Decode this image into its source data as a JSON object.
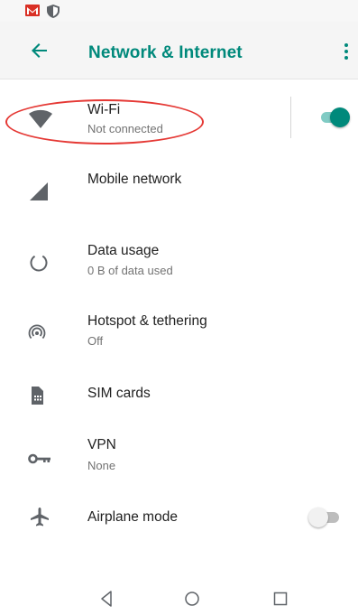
{
  "statusbar": {
    "icons": [
      "gmail-icon",
      "shield-icon"
    ]
  },
  "toolbar": {
    "title": "Network & Internet",
    "accent_color": "#00897b"
  },
  "items": [
    {
      "id": "wifi",
      "title": "Wi-Fi",
      "subtitle": "Not connected",
      "icon": "wifi-icon",
      "toggle": true,
      "toggle_on": true
    },
    {
      "id": "mobile",
      "title": "Mobile network",
      "subtitle": "",
      "icon": "cell-signal-icon"
    },
    {
      "id": "data",
      "title": "Data usage",
      "subtitle": "0 B of data used",
      "icon": "data-usage-icon"
    },
    {
      "id": "hotspot",
      "title": "Hotspot & tethering",
      "subtitle": "Off",
      "icon": "hotspot-icon"
    },
    {
      "id": "sim",
      "title": "SIM cards",
      "subtitle": "",
      "icon": "sim-card-icon"
    },
    {
      "id": "vpn",
      "title": "VPN",
      "subtitle": "None",
      "icon": "key-icon"
    },
    {
      "id": "airplane",
      "title": "Airplane mode",
      "subtitle": "",
      "icon": "airplane-icon",
      "toggle": true,
      "toggle_on": false
    }
  ],
  "annotation": {
    "color": "#e53935",
    "shape": "ellipse",
    "target": "wifi"
  },
  "navbar": {
    "buttons": [
      "back-nav-icon",
      "home-nav-icon",
      "recents-nav-icon"
    ]
  }
}
